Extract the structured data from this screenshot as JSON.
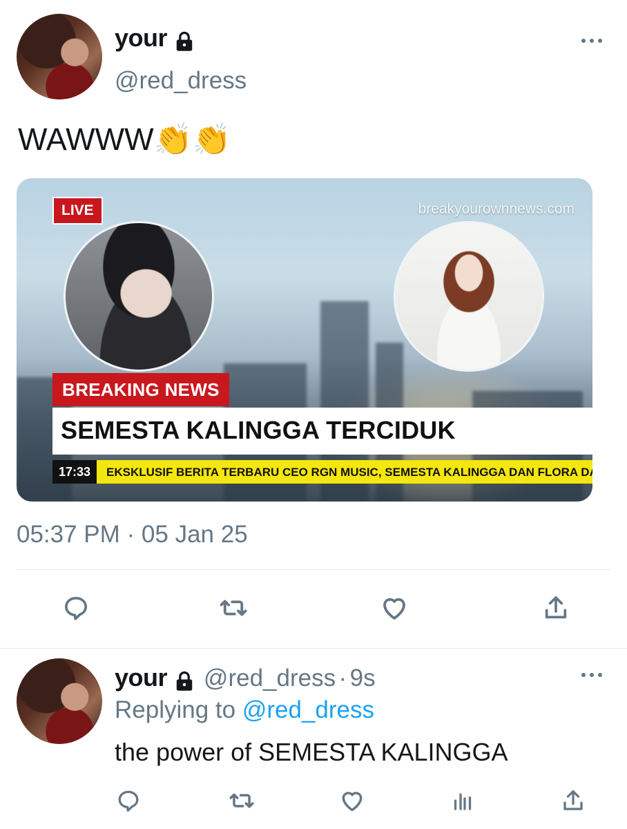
{
  "tweet": {
    "display_name": "your",
    "handle": "@red_dress",
    "text": "WAWWW👏👏",
    "timestamp": "05:37 PM · 05 Jan 25",
    "image": {
      "live_badge": "LIVE",
      "website": "breakyourownnews.com",
      "breaking_label": "BREAKING NEWS",
      "headline": "SEMESTA KALINGGA TERCIDUK",
      "clock": "17:33",
      "ticker": "EKSKLUSIF BERITA TERBARU CEO RGN MUSIC, SEMESTA KALINGGA DAN FLORA DAVIAI"
    },
    "actions": [
      "reply-icon",
      "retweet-icon",
      "like-icon",
      "share-icon"
    ]
  },
  "reply": {
    "display_name": "your",
    "handle": "@red_dress",
    "separator": "·",
    "age": "9s",
    "replying_prefix": "Replying to",
    "replying_handle": "@red_dress",
    "text": "the power of SEMESTA KALINGGA",
    "actions": [
      "reply-icon",
      "retweet-icon",
      "like-icon",
      "analytics-icon",
      "share-icon"
    ]
  },
  "colors": {
    "secondary_text": "#657786",
    "link": "#1da1f2",
    "breaking_red": "#c8181e",
    "ticker_yellow": "#f4e60f"
  }
}
